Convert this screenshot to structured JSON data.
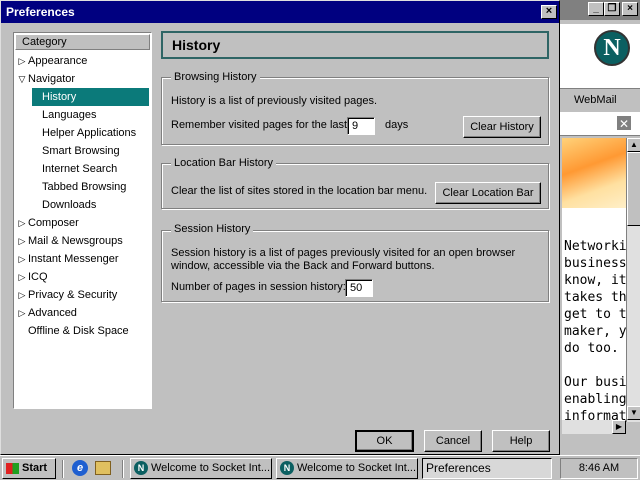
{
  "dialog": {
    "title": "Preferences",
    "close_glyph": "×",
    "category_header": "Category",
    "categories": [
      {
        "label": "Appearance",
        "arrow": "▷"
      },
      {
        "label": "Navigator",
        "arrow": "▽"
      },
      {
        "label": "History",
        "arrow": ""
      },
      {
        "label": "Languages",
        "arrow": ""
      },
      {
        "label": "Helper Applications",
        "arrow": ""
      },
      {
        "label": "Smart Browsing",
        "arrow": ""
      },
      {
        "label": "Internet Search",
        "arrow": ""
      },
      {
        "label": "Tabbed Browsing",
        "arrow": ""
      },
      {
        "label": "Downloads",
        "arrow": ""
      },
      {
        "label": "Composer",
        "arrow": "▷"
      },
      {
        "label": "Mail & Newsgroups",
        "arrow": "▷"
      },
      {
        "label": "Instant Messenger",
        "arrow": "▷"
      },
      {
        "label": "ICQ",
        "arrow": "▷"
      },
      {
        "label": "Privacy & Security",
        "arrow": "▷"
      },
      {
        "label": "Advanced",
        "arrow": "▷"
      },
      {
        "label": "Offline & Disk Space",
        "arrow": ""
      }
    ],
    "panel_title": "History",
    "browsing": {
      "group_title": "Browsing History",
      "description": "History is a list of previously visited pages.",
      "remember_label": "Remember visited pages for the last",
      "days_value": "9",
      "days_label": "days",
      "clear_button": "Clear History"
    },
    "location": {
      "group_title": "Location Bar History",
      "description": "Clear the list of sites stored in the location bar menu.",
      "clear_button": "Clear Location Bar"
    },
    "session": {
      "group_title": "Session History",
      "description_line1": "Session history is a list of pages previously visited for an open browser",
      "description_line2": "window, accessible via the Back and Forward buttons.",
      "pages_label": "Number of pages in session history:",
      "pages_value": "50"
    },
    "ok_button": "OK",
    "cancel_button": "Cancel",
    "help_button": "Help"
  },
  "browser": {
    "minimize_glyph": "_",
    "restore_glyph": "❐",
    "close_glyph": "×",
    "logo_letter": "N",
    "webmail_label": "WebMail",
    "text_lines": [
      "Networkin",
      "business.",
      "know, it's",
      "takes the",
      "get to th",
      "maker, yo",
      "do too.",
      "",
      "Our busin",
      "enabling ",
      "informatio"
    ]
  },
  "taskbar": {
    "start_label": "Start",
    "items": [
      "Welcome to Socket Int...",
      "Welcome to Socket Int...",
      "Preferences"
    ],
    "clock": "8:46 AM"
  },
  "colors": {
    "titlebar": "#000080",
    "selection": "#0b7a7a",
    "header_border": "#2e6565"
  }
}
